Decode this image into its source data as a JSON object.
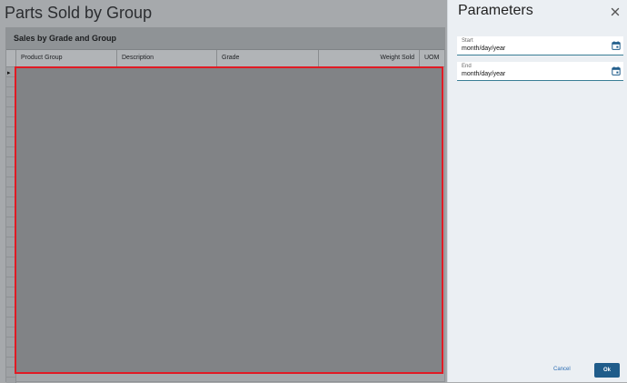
{
  "report": {
    "title": "Parts Sold by Group",
    "panel_title": "Sales by Grade and Group",
    "columns": [
      "Product Group",
      "Description",
      "Grade",
      "Weight Sold",
      "UOM"
    ],
    "row_marker": "▸"
  },
  "parameters": {
    "title": "Parameters",
    "close_icon": "close-icon",
    "start": {
      "label": "Start",
      "value": "month/day/year",
      "icon": "calendar-icon"
    },
    "end": {
      "label": "End",
      "value": "month/day/year",
      "icon": "calendar-icon"
    },
    "cancel_label": "Cancel",
    "ok_label": "Ok"
  },
  "colors": {
    "accent": "#1f5c8a",
    "highlight_border": "#e01b24",
    "field_underline": "#3a7e95"
  }
}
